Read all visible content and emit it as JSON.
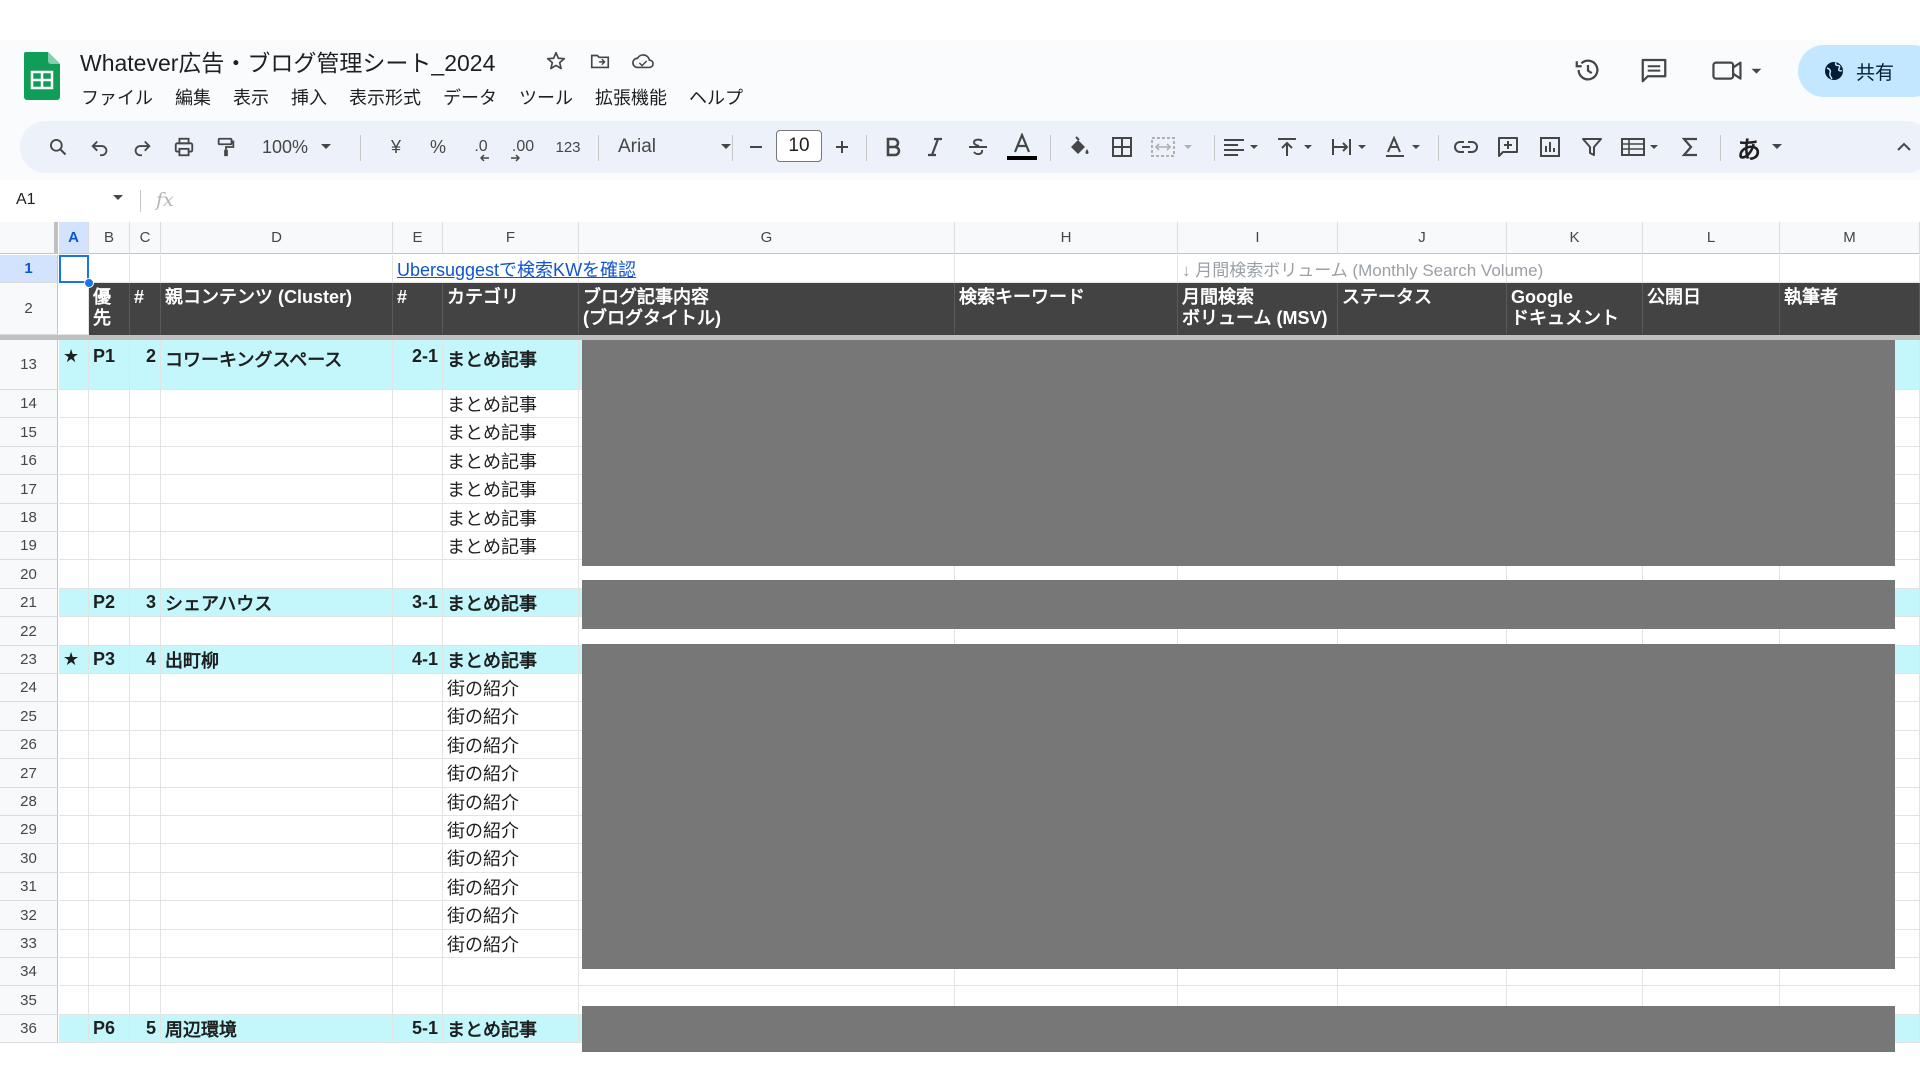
{
  "document": {
    "title": "Whatever広告・ブログ管理シート_2024"
  },
  "menu": [
    "ファイル",
    "編集",
    "表示",
    "挿入",
    "表示形式",
    "データ",
    "ツール",
    "拡張機能",
    "ヘルプ"
  ],
  "header_actions": {
    "share_label": "共有",
    "icons": [
      "version-history-icon",
      "comments-icon",
      "meet-icon"
    ]
  },
  "toolbar": {
    "zoom": "100%",
    "currency": "¥",
    "percent": "%",
    "dec_decrease": ".0",
    "dec_increase": ".00",
    "number_format": "123",
    "font": "Arial",
    "font_size": "10",
    "input_tools": "あ"
  },
  "formula_bar": {
    "cell_ref": "A1",
    "fx": "fx",
    "value": ""
  },
  "columns": [
    "A",
    "B",
    "C",
    "D",
    "E",
    "F",
    "G",
    "H",
    "I",
    "J",
    "K",
    "L",
    "M"
  ],
  "row1": {
    "link": "Ubersuggestで検索KWを確認",
    "msv_note": "↓ 月間検索ボリューム (Monthly Search Volume)"
  },
  "header_row": {
    "B": "優先",
    "C": "#",
    "D": "親コンテンツ (Cluster)",
    "E": "#",
    "F": "カテゴリ",
    "G": "ブログ記事内容\n(ブログタイトル)",
    "H": "検索キーワード",
    "I": "月間検索\nボリューム (MSV)",
    "J": "ステータス",
    "K": "Google\nドキュメント",
    "L": "公開日",
    "M": "執筆者"
  },
  "rows": [
    {
      "num": "13",
      "star": "★",
      "priority": "P1",
      "id": "2",
      "cluster": "コワーキングスペース",
      "sub": "2-1",
      "category": "まとめ記事",
      "highlight": true
    },
    {
      "num": "14",
      "category": "まとめ記事"
    },
    {
      "num": "15",
      "category": "まとめ記事"
    },
    {
      "num": "16",
      "category": "まとめ記事"
    },
    {
      "num": "17",
      "category": "まとめ記事"
    },
    {
      "num": "18",
      "category": "まとめ記事"
    },
    {
      "num": "19",
      "category": "まとめ記事"
    },
    {
      "num": "20"
    },
    {
      "num": "21",
      "priority": "P2",
      "id": "3",
      "cluster": "シェアハウス",
      "sub": "3-1",
      "category": "まとめ記事",
      "highlight": true
    },
    {
      "num": "22"
    },
    {
      "num": "23",
      "star": "★",
      "priority": "P3",
      "id": "4",
      "cluster": "出町柳",
      "sub": "4-1",
      "category": "まとめ記事",
      "highlight": true
    },
    {
      "num": "24",
      "category": "街の紹介"
    },
    {
      "num": "25",
      "category": "街の紹介"
    },
    {
      "num": "26",
      "category": "街の紹介"
    },
    {
      "num": "27",
      "category": "街の紹介"
    },
    {
      "num": "28",
      "category": "街の紹介"
    },
    {
      "num": "29",
      "category": "街の紹介"
    },
    {
      "num": "30",
      "category": "街の紹介"
    },
    {
      "num": "31",
      "category": "街の紹介"
    },
    {
      "num": "32",
      "category": "街の紹介"
    },
    {
      "num": "33",
      "category": "街の紹介"
    },
    {
      "num": "34"
    },
    {
      "num": "35"
    },
    {
      "num": "36",
      "priority": "P6",
      "id": "5",
      "cluster": "周辺環境",
      "sub": "5-1",
      "category": "まとめ記事",
      "highlight": true
    }
  ],
  "colors": {
    "highlight_row": "#c4f7fc",
    "header_dark": "#434343",
    "redacted": "#777777",
    "share_button": "#c2e7ff",
    "toolbar_bg": "#edf2fa",
    "sheets_green": "#0f9d58"
  }
}
